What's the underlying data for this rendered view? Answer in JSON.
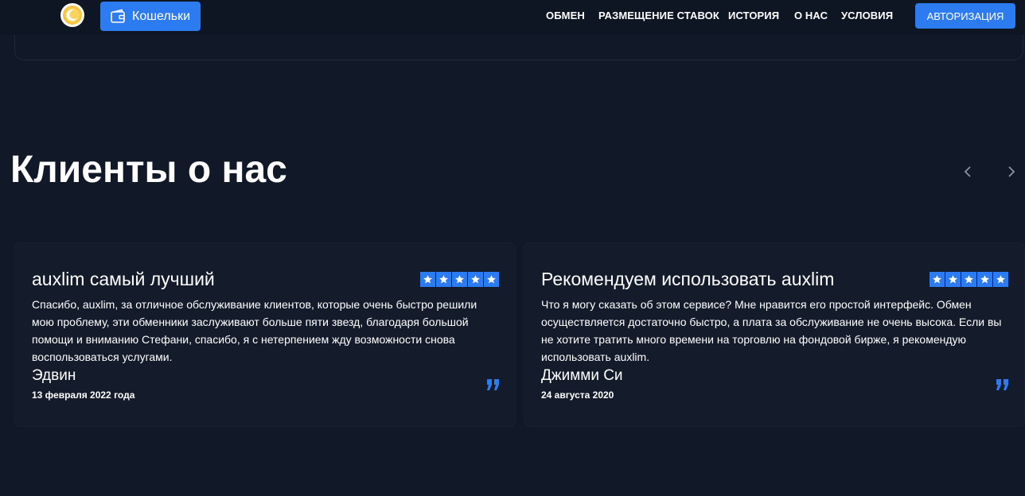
{
  "header": {
    "logo_icon": "coin-logo-icon",
    "wallets_button": {
      "label": "Кошельки",
      "icon": "wallet-icon"
    },
    "nav": [
      {
        "label": "ОБМЕН"
      },
      {
        "label": "РАЗМЕЩЕНИЕ СТАВОК"
      },
      {
        "label": "ИСТОРИЯ"
      },
      {
        "label": "О НАС"
      },
      {
        "label": "УСЛОВИЯ"
      }
    ],
    "auth_button": {
      "label": "АВТОРИЗАЦИЯ"
    }
  },
  "testimonials": {
    "title": "Клиенты о нас",
    "prev_icon": "chevron-left-icon",
    "next_icon": "chevron-right-icon",
    "items": [
      {
        "title": "auxlim самый лучший",
        "rating": 5,
        "text": "Спасибо, auxlim, за отличное обслуживание клиентов, которые очень быстро решили мою проблему, эти обменники заслуживают больше пяти звезд, благодаря большой помощи и вниманию Стефани, спасибо, я с нетерпением жду возможности снова воспользоваться услугами.",
        "author": "Эдвин",
        "date": "13 февраля 2022 года"
      },
      {
        "title": "Рекомендуем использовать auxlim",
        "rating": 5,
        "text": "Что я могу сказать об этом сервисе? Мне нравится его простой интерфейс. Обмен осуществляется достаточно быстро, а плата за обслуживание не очень высока. Если вы не хотите тратить много времени на торговлю на фондовой бирже, я рекомендую использовать auxlim.",
        "author": "Джимми Си",
        "date": "24 августа 2020"
      }
    ]
  },
  "colors": {
    "background": "#111827",
    "accent": "#2d7bf0",
    "card": "#141c2b"
  }
}
